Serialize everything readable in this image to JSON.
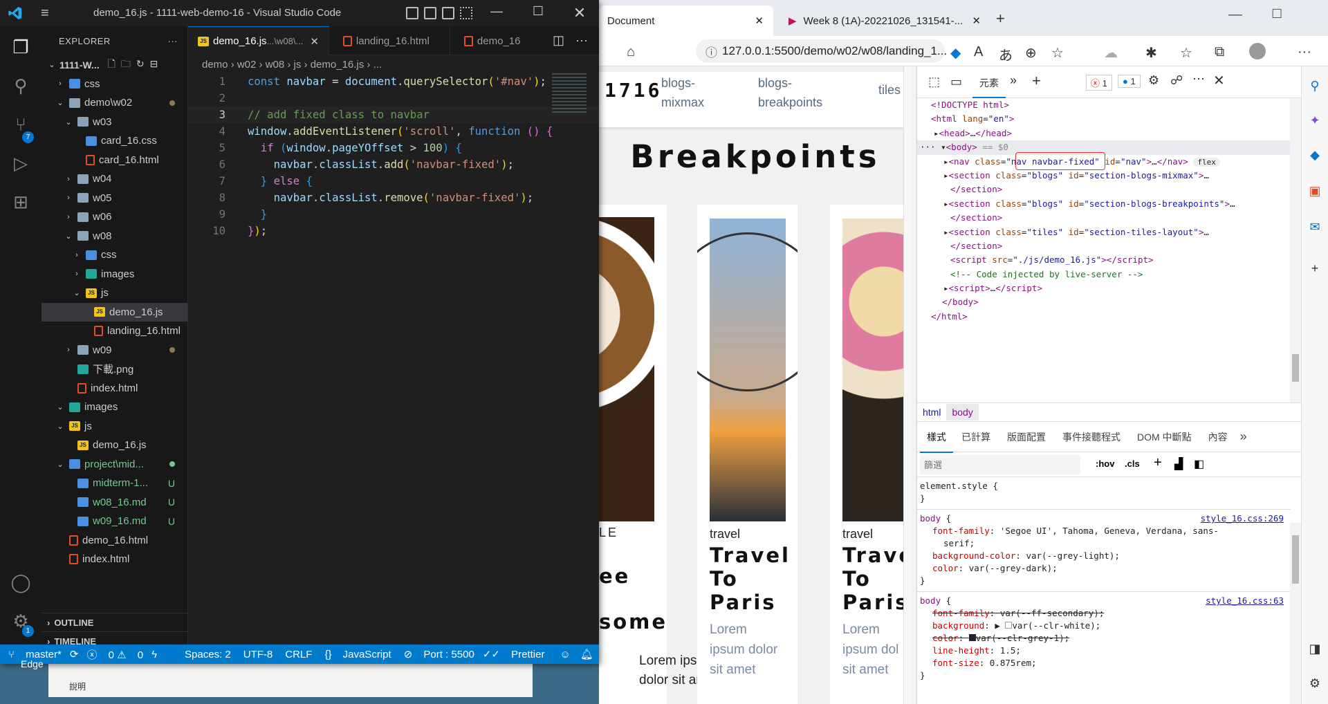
{
  "vscode": {
    "title": "demo_16.js - 1111-web-demo-16 - Visual Studio Code",
    "explorer_label": "EXPLORER",
    "project_name": "1111-W...",
    "outline_label": "OUTLINE",
    "timeline_label": "TIMELINE",
    "scm_badge": "7",
    "settings_badge": "1",
    "tree": [
      {
        "label": "css",
        "indent": 1,
        "icon": "fi-css",
        "chev": "›"
      },
      {
        "label": "demo\\w02",
        "indent": 1,
        "icon": "fi-folder",
        "chev": "⌄",
        "dot": "mod"
      },
      {
        "label": "w03",
        "indent": 2,
        "icon": "fi-folder",
        "chev": "⌄"
      },
      {
        "label": "card_16.css",
        "indent": 3,
        "icon": "fi-css",
        "chev": ""
      },
      {
        "label": "card_16.html",
        "indent": 3,
        "icon": "fi-html",
        "chev": ""
      },
      {
        "label": "w04",
        "indent": 2,
        "icon": "fi-folder",
        "chev": "›"
      },
      {
        "label": "w05",
        "indent": 2,
        "icon": "fi-folder",
        "chev": "›"
      },
      {
        "label": "w06",
        "indent": 2,
        "icon": "fi-folder",
        "chev": "›"
      },
      {
        "label": "w08",
        "indent": 2,
        "icon": "fi-folder",
        "chev": "⌄"
      },
      {
        "label": "css",
        "indent": 3,
        "icon": "fi-css",
        "chev": "›"
      },
      {
        "label": "images",
        "indent": 3,
        "icon": "fi-img",
        "chev": "›"
      },
      {
        "label": "js",
        "indent": 3,
        "icon": "fi-js",
        "chev": "⌄"
      },
      {
        "label": "demo_16.js",
        "indent": 4,
        "icon": "fi-js",
        "chev": "",
        "selected": true
      },
      {
        "label": "landing_16.html",
        "indent": 4,
        "icon": "fi-html",
        "chev": ""
      },
      {
        "label": "w09",
        "indent": 2,
        "icon": "fi-folder",
        "chev": "›",
        "dot": "mod"
      },
      {
        "label": "下載.png",
        "indent": 2,
        "icon": "fi-png",
        "chev": ""
      },
      {
        "label": "index.html",
        "indent": 2,
        "icon": "fi-html",
        "chev": ""
      },
      {
        "label": "images",
        "indent": 1,
        "icon": "fi-img",
        "chev": "⌄"
      },
      {
        "label": "js",
        "indent": 1,
        "icon": "fi-js",
        "chev": "⌄"
      },
      {
        "label": "demo_16.js",
        "indent": 2,
        "icon": "fi-js",
        "chev": ""
      },
      {
        "label": "project\\mid...",
        "indent": 1,
        "icon": "fi-md",
        "chev": "⌄",
        "dot": "green",
        "git": true
      },
      {
        "label": "midterm-1...",
        "indent": 2,
        "icon": "fi-md",
        "chev": "",
        "u": "U",
        "git": true
      },
      {
        "label": "w08_16.md",
        "indent": 2,
        "icon": "fi-md",
        "chev": "",
        "u": "U",
        "git": true
      },
      {
        "label": "w09_16.md",
        "indent": 2,
        "icon": "fi-md",
        "chev": "",
        "u": "U",
        "git": true
      },
      {
        "label": "demo_16.html",
        "indent": 1,
        "icon": "fi-html",
        "chev": ""
      },
      {
        "label": "index.html",
        "indent": 1,
        "icon": "fi-html",
        "chev": ""
      }
    ],
    "tabs": [
      {
        "label": "demo_16.js",
        "suffix": " ...\\w08\\...",
        "active": true,
        "icon": "fi-js"
      },
      {
        "label": "landing_16.html",
        "active": false,
        "icon": "fi-html"
      },
      {
        "label": "demo_16",
        "active": false,
        "icon": "fi-html"
      }
    ],
    "breadcrumb": "demo  ›  w02  ›  w08  ›  js  ›  demo_16.js  ›  ...",
    "code_lines": [
      "1",
      "2",
      "3",
      "4",
      "5",
      "6",
      "7",
      "8",
      "9",
      "10"
    ],
    "status": {
      "branch": "master*",
      "errors": "0",
      "warnings": "0",
      "spaces": "Spaces: 2",
      "encoding": "UTF-8",
      "eol": "CRLF",
      "language": "JavaScript",
      "port": "Port : 5500",
      "prettier": "Prettier"
    }
  },
  "browser": {
    "tab1": "Document",
    "tab2": "Week 8 (1A)-20221026_131541-...",
    "url": "127.0.0.1:5500/demo/w02/w08/landing_1...",
    "page": {
      "brand": "1716",
      "nav1a": "blogs-",
      "nav1b": "mixmax",
      "nav2a": "blogs-",
      "nav2b": "breakpoints",
      "nav3": "tiles",
      "heading": "Breakpoints",
      "card1_cat": "LE",
      "card1_t1": "ee",
      "card1_t2": "some",
      "card1_lorem1": "Lorem ipsum",
      "card1_lorem2": "dolor sit amet",
      "card2_cat": "travel",
      "card2_t1": "Travel",
      "card2_t2": "To",
      "card2_t3": "Paris",
      "card2_l1": "Lorem",
      "card2_l2": "ipsum dolor",
      "card2_l3": "sit amet",
      "card3_cat": "travel",
      "card3_t1": "Trave",
      "card3_t2": "To",
      "card3_t3": "Paris",
      "card3_l1": "Lorem",
      "card3_l2": "ipsum dol",
      "card3_l3": "sit amet"
    },
    "devtools": {
      "elements_tab": "元素",
      "err_count": "1",
      "msg_count": "1",
      "crumb_html": "html",
      "crumb_body": "body",
      "subtabs": [
        "樣式",
        "已計算",
        "版面配置",
        "事件接聽程式",
        "DOM 中斷點",
        "內容"
      ],
      "filter_placeholder": "篩選",
      "hov": ":hov",
      "cls": ".cls",
      "flex_badge": "flex",
      "src1": "style_16.css:269",
      "src2": "style_16.css:63"
    },
    "taskbar": {
      "edge_label": "Edge",
      "help_label": "說明"
    }
  }
}
